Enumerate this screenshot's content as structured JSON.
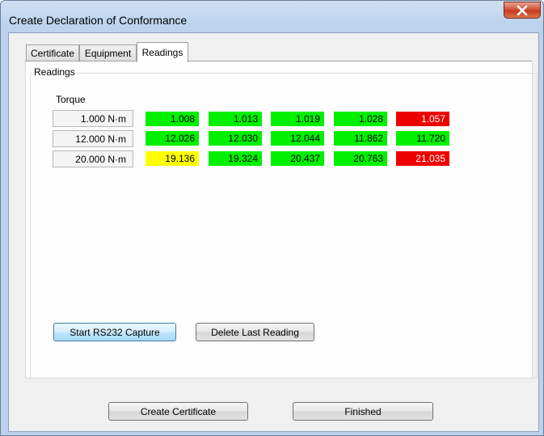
{
  "window": {
    "title": "Create Declaration of Conformance"
  },
  "tabs": [
    {
      "label": "Certificate",
      "active": false
    },
    {
      "label": "Equipment",
      "active": false
    },
    {
      "label": "Readings",
      "active": true
    }
  ],
  "readings": {
    "group_label": "Readings",
    "column_header": "Torque",
    "rows": [
      {
        "label": "1.000 N·m",
        "values": [
          "1.008",
          "1.013",
          "1.019",
          "1.028",
          "1.057"
        ],
        "status": [
          "green",
          "green",
          "green",
          "green",
          "red"
        ]
      },
      {
        "label": "12.000 N·m",
        "values": [
          "12.026",
          "12.030",
          "12.044",
          "11.862",
          "11.720"
        ],
        "status": [
          "green",
          "green",
          "green",
          "green",
          "green"
        ]
      },
      {
        "label": "20.000 N·m",
        "values": [
          "19.136",
          "19.324",
          "20.437",
          "20.763",
          "21.035"
        ],
        "status": [
          "yellow",
          "green",
          "green",
          "green",
          "red"
        ]
      }
    ],
    "colors": {
      "green": "#00f000",
      "red": "#ee0000",
      "yellow": "#ffff00"
    }
  },
  "buttons": {
    "start_capture": "Start RS232 Capture",
    "delete_last": "Delete Last Reading",
    "create_certificate": "Create Certificate",
    "finished": "Finished"
  }
}
